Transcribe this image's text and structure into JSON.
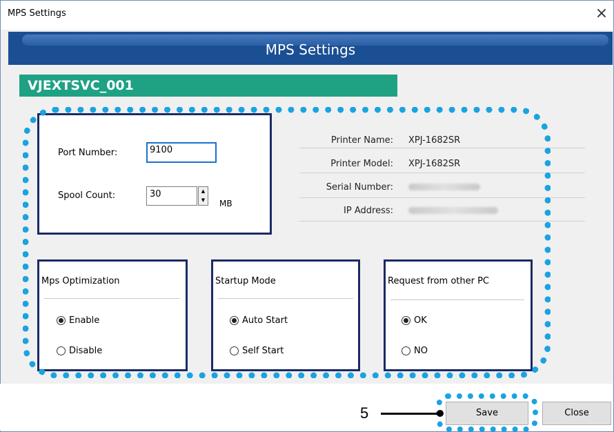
{
  "window": {
    "title": "MPS Settings",
    "close_glyph": "×"
  },
  "banner": {
    "title": "MPS Settings"
  },
  "section": {
    "name": "VJEXTSVC_001"
  },
  "port": {
    "label": "Port Number:",
    "value": "9100"
  },
  "spool": {
    "label": "Spool Count:",
    "value": "30",
    "unit": "MB"
  },
  "printer_info": {
    "rows": [
      {
        "label": "Printer Name:",
        "value": "XPJ-1682SR"
      },
      {
        "label": "Printer Model:",
        "value": "XPJ-1682SR"
      },
      {
        "label": "Serial Number:",
        "value": ""
      },
      {
        "label": "IP Address:",
        "value": ""
      }
    ]
  },
  "groups": {
    "mps_optimization": {
      "title": "Mps Optimization",
      "options": [
        "Enable",
        "Disable"
      ],
      "selected": "Enable"
    },
    "startup_mode": {
      "title": "Startup Mode",
      "options": [
        "Auto Start",
        "Self Start"
      ],
      "selected": "Auto Start"
    },
    "request_other_pc": {
      "title": "Request from other PC",
      "options": [
        "OK",
        "NO"
      ],
      "selected": "OK"
    }
  },
  "buttons": {
    "save": "Save",
    "close": "Close"
  },
  "callout": {
    "number": "5"
  },
  "colors": {
    "banner": "#1b4f93",
    "section_header": "#1fa184",
    "highlight_dots": "#1aa3e0",
    "box_border": "#1a2a66"
  },
  "icons": {
    "close": "close-icon",
    "spin_up": "spin-up-icon",
    "spin_down": "spin-down-icon"
  }
}
